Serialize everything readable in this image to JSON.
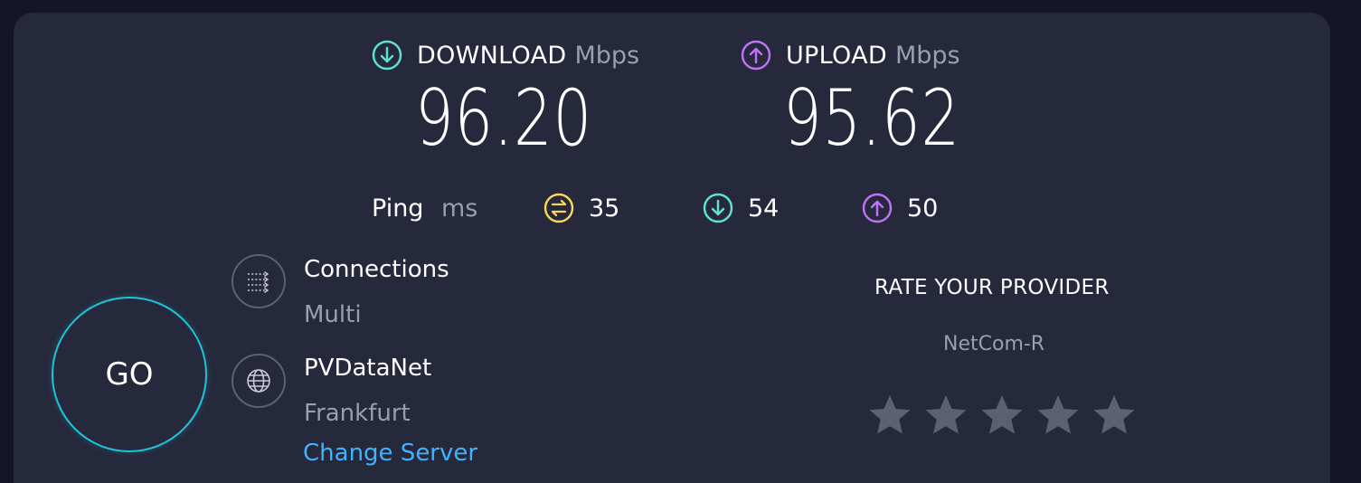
{
  "results": {
    "download": {
      "label": "DOWNLOAD",
      "unit": "Mbps",
      "value": "96.20",
      "icon": "download-arrow-icon",
      "color": "#5fe0d2"
    },
    "upload": {
      "label": "UPLOAD",
      "unit": "Mbps",
      "value": "95.62",
      "icon": "upload-arrow-icon",
      "color": "#bf71f5"
    }
  },
  "ping": {
    "label": "Ping",
    "unit": "ms",
    "idle": {
      "value": "35",
      "icon": "ping-idle-icon",
      "color": "#f4d35e"
    },
    "download": {
      "value": "54",
      "icon": "download-arrow-icon",
      "color": "#5fe0d2"
    },
    "upload": {
      "value": "50",
      "icon": "upload-arrow-icon",
      "color": "#bf71f5"
    }
  },
  "go_button": {
    "label": "GO",
    "color": "#1fc4d8"
  },
  "connections": {
    "title": "Connections",
    "value": "Multi",
    "icon": "connections-icon"
  },
  "server": {
    "name": "PVDataNet",
    "location": "Frankfurt",
    "icon": "globe-icon",
    "change_label": "Change Server",
    "link_color": "#3fb3ff"
  },
  "rating": {
    "title": "RATE YOUR PROVIDER",
    "provider": "NetCom-R",
    "stars_total": 5,
    "stars_selected": 0,
    "star_color": "#5d5f73"
  }
}
